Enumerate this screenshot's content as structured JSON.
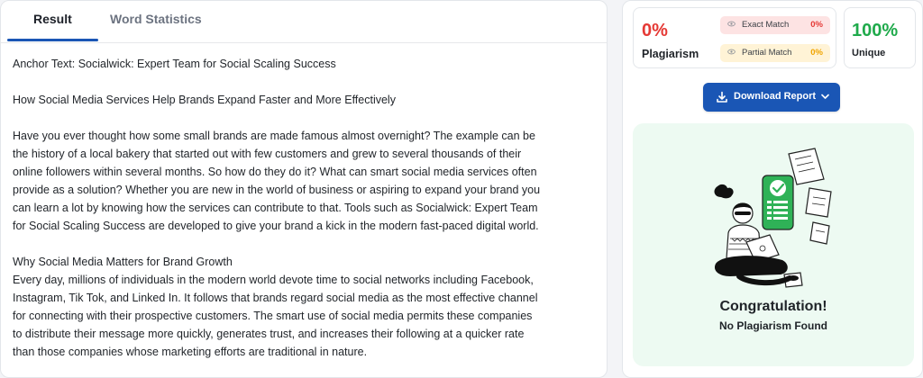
{
  "tabs": {
    "result": "Result",
    "word_stats": "Word Statistics"
  },
  "content": {
    "anchor": "Anchor Text: Socialwick: Expert Team for Social Scaling Success",
    "heading1": "How Social Media Services Help Brands Expand Faster and More Effectively",
    "para1": [
      "Have you ever thought how some small brands are made famous almost overnight? The example can be",
      "the history of a local bakery that started out with few customers and grew to several thousands of their",
      "online followers within several months. So how do they do it? What can smart social media services often",
      "provide as a solution? Whether you are new in the world of business or aspiring to expand your brand you",
      "can learn a lot by knowing how the services can contribute to that. Tools such as Socialwick: Expert Team",
      "for Social Scaling Success are developed to give your brand a kick in the modern fast-paced digital world."
    ],
    "heading2": "Why Social Media Matters for Brand Growth",
    "para2": [
      "Every day, millions of individuals in the modern world devote time to social networks including Facebook,",
      "Instagram, Tik Tok, and Linked In. It follows that brands regard social media as the most effective channel",
      "for connecting with their prospective customers. The smart use of social media permits these companies",
      "to distribute their message more quickly, generates trust, and increases their following at a quicker rate",
      "than those companies whose marketing efforts are traditional in nature."
    ]
  },
  "stats": {
    "plagiarism_pct": "0%",
    "plagiarism_label": "Plagiarism",
    "exact_label": "Exact Match",
    "exact_val": "0%",
    "partial_label": "Partial Match",
    "partial_val": "0%",
    "unique_pct": "100%",
    "unique_label": "Unique"
  },
  "download": {
    "label": "Download Report",
    "icon": "download-icon"
  },
  "result_box": {
    "title": "Congratulation!",
    "subtitle": "No Plagiarism Found"
  },
  "colors": {
    "accent": "#1a56b5",
    "danger": "#e53935",
    "warning": "#f0a400",
    "success": "#1faa4b"
  }
}
